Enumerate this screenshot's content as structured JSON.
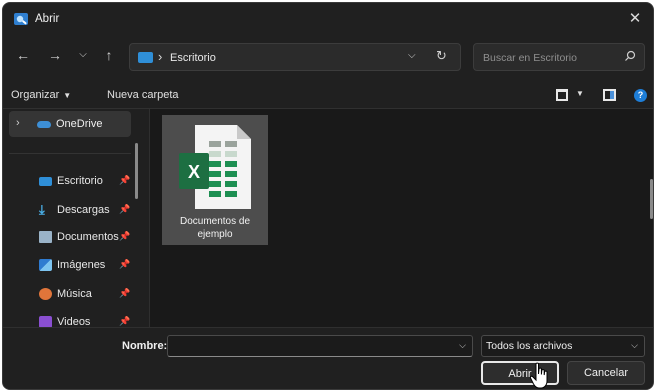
{
  "window": {
    "title": "Abrir"
  },
  "address": {
    "current_folder": "Escritorio"
  },
  "search": {
    "placeholder": "Buscar en Escritorio"
  },
  "toolbar": {
    "organize_label": "Organizar",
    "new_folder_label": "Nueva carpeta"
  },
  "sidebar": {
    "onedrive_label": "OneDrive",
    "quick_access": [
      {
        "label": "Escritorio",
        "icon": "desktop-icon",
        "pinned": true
      },
      {
        "label": "Descargas",
        "icon": "download-icon",
        "pinned": true
      },
      {
        "label": "Documentos",
        "icon": "documents-icon",
        "pinned": true
      },
      {
        "label": "Imágenes",
        "icon": "pictures-icon",
        "pinned": true
      },
      {
        "label": "Música",
        "icon": "music-icon",
        "pinned": true
      },
      {
        "label": "Videos",
        "icon": "videos-icon",
        "pinned": true
      }
    ]
  },
  "content": {
    "files": [
      {
        "name": "Documentos de ejemplo",
        "icon": "excel-file-icon",
        "selected": true
      }
    ]
  },
  "bottom": {
    "name_label": "Nombre:",
    "name_value": "",
    "file_type": "Todos los archivos",
    "open_label": "Abrir",
    "cancel_label": "Cancelar"
  },
  "colors": {
    "background": "#202020",
    "content_bg": "#191919",
    "accent": "#2f8fd8",
    "excel_green": "#1d6f42",
    "selected_tile": "#4d4d4d"
  }
}
